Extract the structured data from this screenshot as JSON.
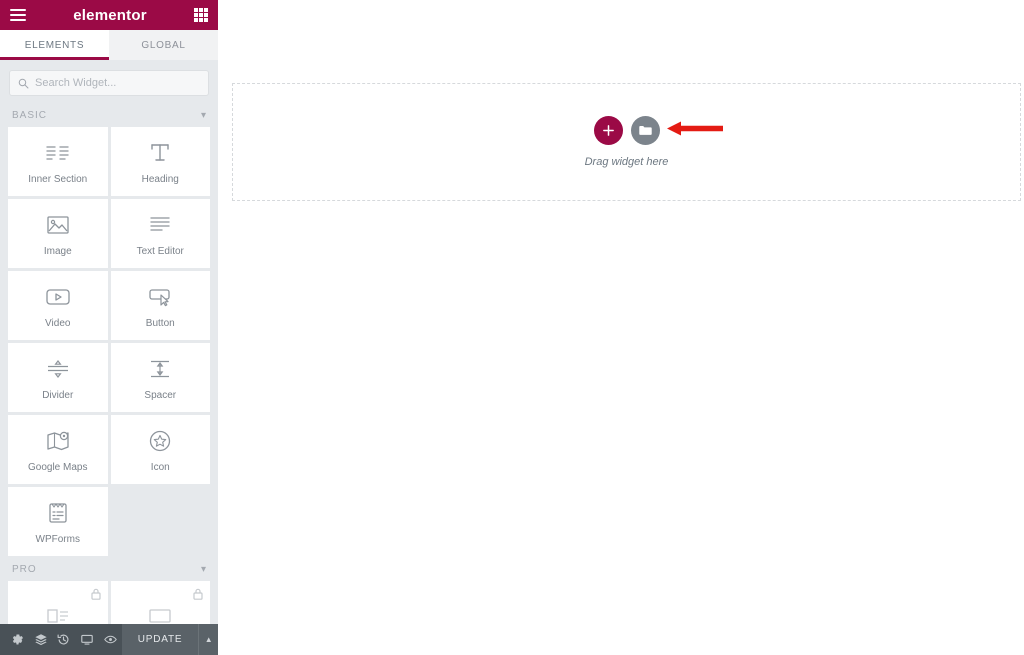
{
  "header": {
    "logo_text": "elementor",
    "menu_icon": "hamburger-menu-icon",
    "apps_icon": "grid-apps-icon",
    "bg_color": "#9b0a46"
  },
  "tabs": [
    {
      "label": "ELEMENTS",
      "active": true
    },
    {
      "label": "GLOBAL",
      "active": false
    }
  ],
  "search": {
    "placeholder": "Search Widget...",
    "value": "",
    "icon": "search-icon"
  },
  "sections": [
    {
      "title": "BASIC",
      "collapse_icon": "chevron-down-icon",
      "widgets": [
        {
          "label": "Inner Section",
          "icon": "inner-section-icon",
          "locked": false
        },
        {
          "label": "Heading",
          "icon": "heading-icon",
          "locked": false
        },
        {
          "label": "Image",
          "icon": "image-icon",
          "locked": false
        },
        {
          "label": "Text Editor",
          "icon": "text-editor-icon",
          "locked": false
        },
        {
          "label": "Video",
          "icon": "video-icon",
          "locked": false
        },
        {
          "label": "Button",
          "icon": "button-icon",
          "locked": false
        },
        {
          "label": "Divider",
          "icon": "divider-icon",
          "locked": false
        },
        {
          "label": "Spacer",
          "icon": "spacer-icon",
          "locked": false
        },
        {
          "label": "Google Maps",
          "icon": "google-maps-icon",
          "locked": false
        },
        {
          "label": "Icon",
          "icon": "star-icon",
          "locked": false
        },
        {
          "label": "WPForms",
          "icon": "wpforms-icon",
          "locked": false
        }
      ]
    },
    {
      "title": "PRO",
      "collapse_icon": "chevron-down-icon",
      "widgets": [
        {
          "label": "",
          "icon": "pro-widget-icon",
          "locked": true
        },
        {
          "label": "",
          "icon": "pro-widget-icon",
          "locked": true
        }
      ]
    }
  ],
  "bottom_bar": {
    "icons": [
      {
        "name": "settings-gear-icon"
      },
      {
        "name": "navigator-layers-icon"
      },
      {
        "name": "history-revisions-icon"
      },
      {
        "name": "responsive-mode-icon"
      },
      {
        "name": "preview-eye-icon"
      }
    ],
    "update_label": "UPDATE",
    "caret_icon": "chevron-up-icon"
  },
  "collapse_handle": {
    "icon": "chevron-left-icon"
  },
  "canvas": {
    "dropzone": {
      "add_section_label": "+",
      "add_section_icon": "plus-icon",
      "template_icon": "folder-icon",
      "hint_text": "Drag widget here"
    },
    "annotation": {
      "name": "red-arrow-pointing-left",
      "color": "#e41b13"
    }
  }
}
